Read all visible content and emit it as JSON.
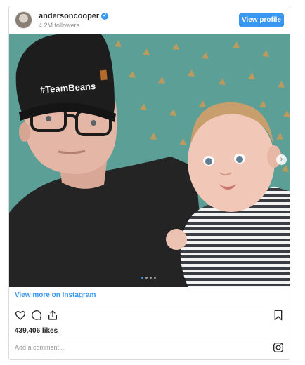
{
  "header": {
    "username": "andersoncooper",
    "verified_mark": "✓",
    "followers": "4.2M followers",
    "view_profile_label": "View profile"
  },
  "photo": {
    "hat_text": "#TeamBeans",
    "next_arrow": "›",
    "carousel_count": 4,
    "carousel_active": 1
  },
  "footer": {
    "view_more_label": "View more on Instagram",
    "likes": "439,406 likes",
    "comment_placeholder": "Add a comment..."
  },
  "icons": [
    "heart-icon",
    "comment-icon",
    "share-icon",
    "bookmark-icon",
    "instagram-icon",
    "verified-icon",
    "chevron-right-icon"
  ],
  "colors": {
    "accent": "#3897f0",
    "wall": "#5a9e96",
    "text": "#262626"
  }
}
